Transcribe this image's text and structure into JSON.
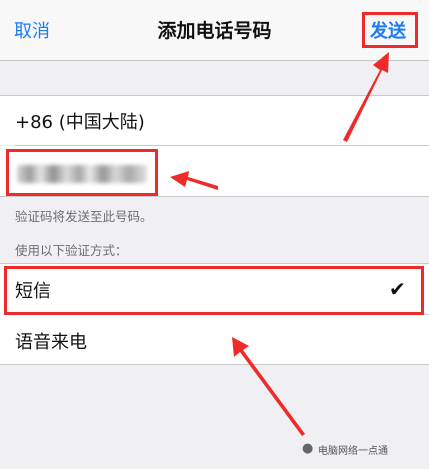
{
  "navbar": {
    "cancel_label": "取消",
    "title": "添加电话号码",
    "send_label": "发送"
  },
  "form": {
    "country_code": "+86 (中国大陆)",
    "phone_hint": "验证码将发送至此号码。",
    "method_header": "使用以下验证方式：",
    "methods": [
      {
        "label": "短信",
        "selected": true
      },
      {
        "label": "语音来电",
        "selected": false
      }
    ]
  },
  "colors": {
    "accent": "#1a7cf4",
    "annotation": "#ee2a2a"
  },
  "watermark": {
    "icon": "wechat-icon",
    "text": "电脑网络一点通"
  }
}
